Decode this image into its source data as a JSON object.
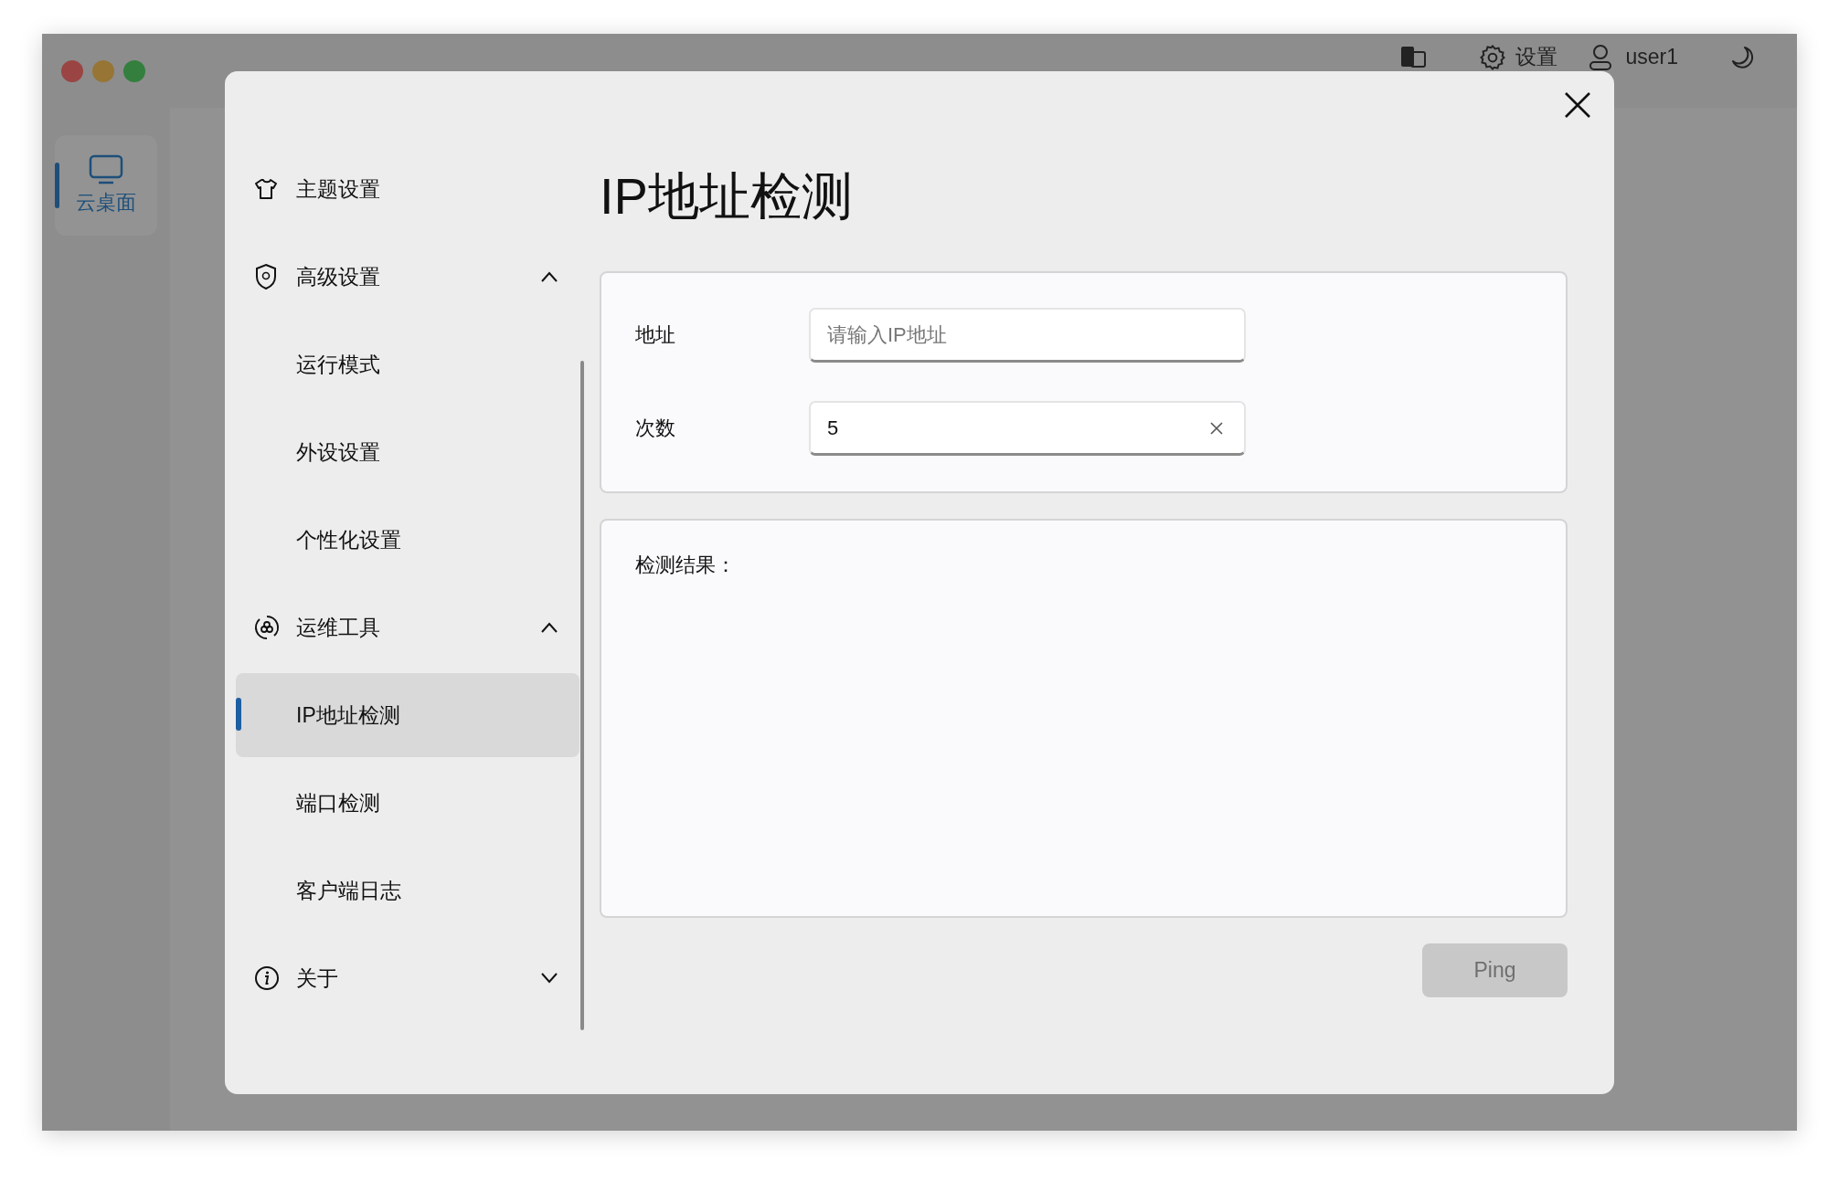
{
  "window": {
    "controls": [
      {
        "color": "#9b4444"
      },
      {
        "color": "#977535"
      },
      {
        "color": "#347f3e"
      }
    ]
  },
  "topbar": {
    "settings_label": "设置",
    "user": "user1"
  },
  "rail": {
    "items": [
      {
        "label": "云桌面",
        "selected": true
      }
    ]
  },
  "dialog": {
    "title": "IP地址检测",
    "nav": [
      {
        "label": "主题设置",
        "selected": false
      },
      {
        "label": "高级设置",
        "selected": false,
        "expanded": true,
        "children": [
          {
            "label": "运行模式",
            "selected": false
          },
          {
            "label": "外设设置",
            "selected": false
          },
          {
            "label": "个性化设置",
            "selected": false
          }
        ]
      },
      {
        "label": "运维工具",
        "selected": false,
        "expanded": true,
        "children": [
          {
            "label": "IP地址检测",
            "selected": true
          },
          {
            "label": "端口检测",
            "selected": false
          },
          {
            "label": "客户端日志",
            "selected": false
          }
        ]
      },
      {
        "label": "关于",
        "selected": false,
        "expanded": false
      }
    ],
    "fields": [
      {
        "label": "地址",
        "placeholder": "请输入IP地址",
        "clearable": false
      },
      {
        "label": "次数",
        "value": "5",
        "clearable": true
      }
    ],
    "result": {
      "label": "检测结果："
    },
    "button": {
      "label": "Ping",
      "disabled": true
    }
  }
}
